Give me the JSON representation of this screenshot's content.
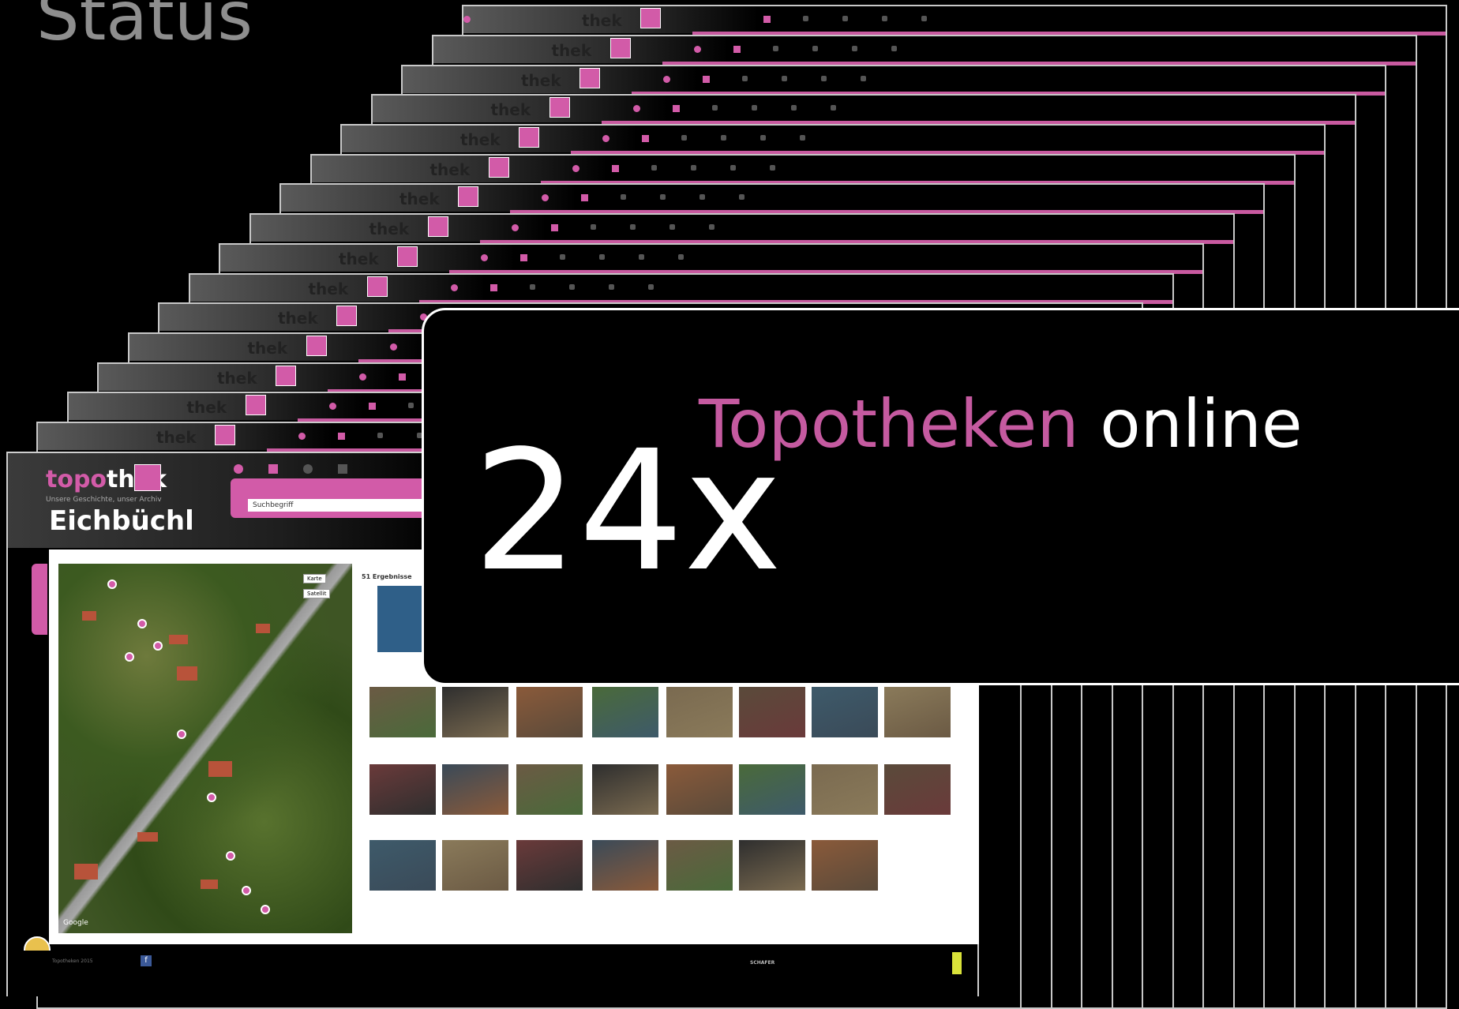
{
  "slide": {
    "title": "Status"
  },
  "brand": {
    "accent": "#d25ba8",
    "logo_prefix": "topo",
    "logo_suffix": "thek",
    "tagline": "Unsere Geschichte, unser Archiv",
    "stacked_logo": "thek"
  },
  "front_window": {
    "place_name": "Eichbüchl",
    "search_value": "Suchbegriff",
    "results_label": "51 Ergebnisse",
    "map_buttons": [
      "Karte",
      "Satellit"
    ],
    "map_attribution": "Google",
    "footer_copyright": "Topotheken 2015",
    "facebook_icon": "f",
    "sponsor": "SCHAFER"
  },
  "overlay": {
    "count": "24x",
    "label_accent": "Topotheken",
    "label_rest": "online"
  },
  "icons": [
    "pin-icon",
    "marker-icon",
    "settings-icon",
    "trophy-icon",
    "list-icon",
    "music-icon",
    "facebook-icon"
  ]
}
